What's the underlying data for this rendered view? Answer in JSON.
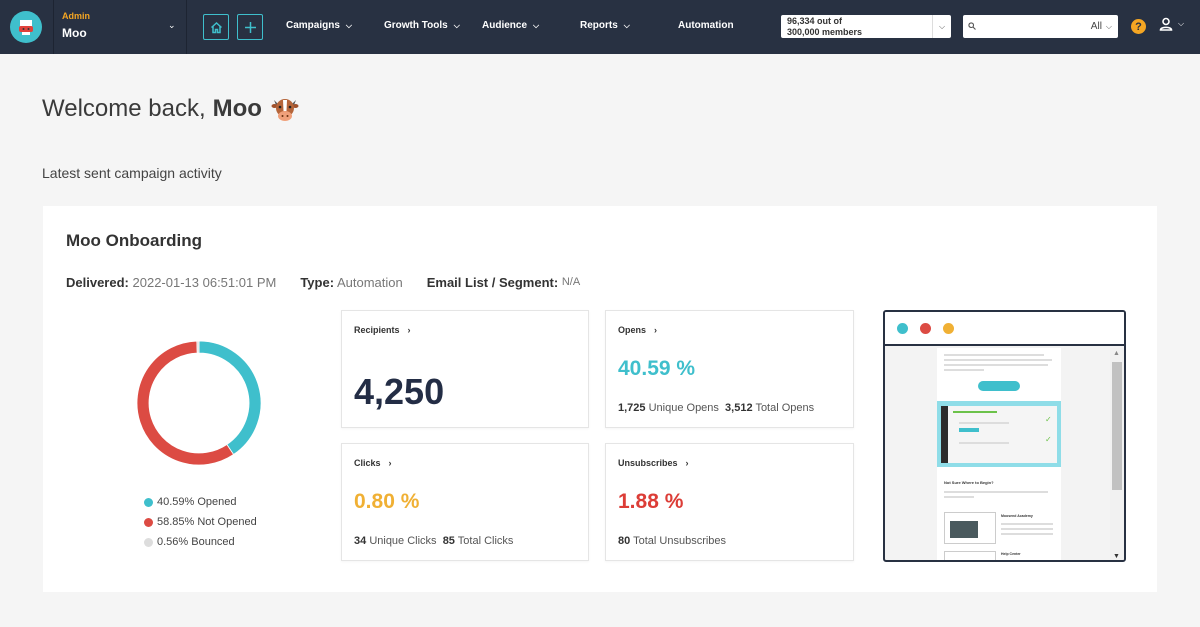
{
  "nav": {
    "account_role": "Admin",
    "account_name": "Moo",
    "items": [
      {
        "label": "Campaigns",
        "has_dropdown": true
      },
      {
        "label": "Growth Tools",
        "has_dropdown": true
      },
      {
        "label": "Audience",
        "has_dropdown": true
      },
      {
        "label": "Reports",
        "has_dropdown": true
      },
      {
        "label": "Automation",
        "has_dropdown": false
      }
    ],
    "members_line1": "96,334 out of",
    "members_line2": "300,000 members",
    "search_placeholder": "",
    "search_scope": "All",
    "help_label": "?"
  },
  "welcome": {
    "greeting": "Welcome back,",
    "name": "Moo"
  },
  "section_title": "Latest sent campaign activity",
  "campaign": {
    "title": "Moo Onboarding",
    "delivered_label": "Delivered:",
    "delivered_value": "2022-01-13 06:51:01 PM",
    "type_label": "Type:",
    "type_value": "Automation",
    "segment_label": "Email List / Segment:",
    "segment_value": "N/A"
  },
  "chart_data": {
    "type": "pie",
    "donut": true,
    "title": "",
    "categories": [
      "Opened",
      "Not Opened",
      "Bounced"
    ],
    "values": [
      40.59,
      58.85,
      0.56
    ],
    "colors": [
      "#3fbfcc",
      "#dc4b43",
      "#dddddd"
    ],
    "legend_labels": [
      "40.59% Opened",
      "58.85% Not Opened",
      "0.56% Bounced"
    ],
    "legend_position": "bottom"
  },
  "stats": {
    "recipients": {
      "label": "Recipients",
      "value": "4,250"
    },
    "opens": {
      "label": "Opens",
      "value": "40.59 %",
      "color": "#3fbfcc",
      "unique_num": "1,725",
      "unique_label": "Unique Opens",
      "total_num": "3,512",
      "total_label": "Total Opens"
    },
    "clicks": {
      "label": "Clicks",
      "value": "0.80 %",
      "color": "#f0b034",
      "unique_num": "34",
      "unique_label": "Unique Clicks",
      "total_num": "85",
      "total_label": "Total Clicks"
    },
    "unsubscribes": {
      "label": "Unsubscribes",
      "value": "1.88 %",
      "color": "#dc3d37",
      "total_num": "80",
      "total_label": "Total Unsubscribes"
    }
  },
  "preview": {
    "dot_colors": [
      "#3fbfcc",
      "#dc4b43",
      "#f0b034"
    ],
    "section_heading": "Not Sure Where to Begin?",
    "card1_title": "Moosend Academy",
    "card2_title": "Help Center"
  }
}
